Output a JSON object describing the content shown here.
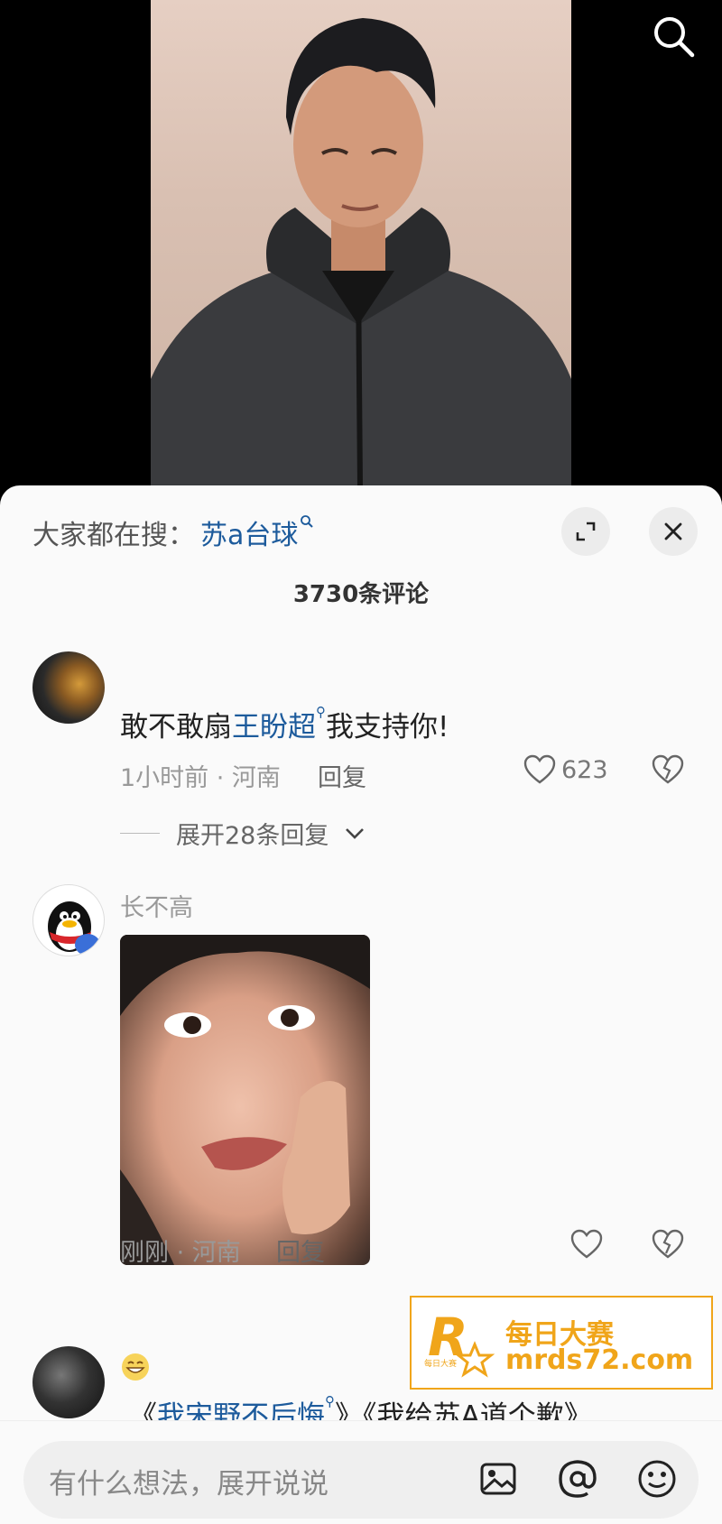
{
  "hot_search": {
    "prefix": "大家都在搜：",
    "term": "苏a台球"
  },
  "comment_count": "3730条评论",
  "comments": [
    {
      "text_before": "敢不敢扇",
      "link": "王盼超",
      "text_after": "我支持你!",
      "meta": "1小时前 · 河南",
      "reply_label": "回复",
      "likes": "623",
      "expand_label": "展开28条回复"
    },
    {
      "username": "长不高",
      "meta": "刚刚 · 河南",
      "reply_label": "回复"
    },
    {
      "text_prefix": "《",
      "link": "我宋野不后悔",
      "text_after": "》《我给苏A道个歉》"
    }
  ],
  "watermark": {
    "line1": "每日大赛",
    "line2": "mrds72.com",
    "badge": "R",
    "badge_small": "每日大赛"
  },
  "input": {
    "placeholder": "有什么想法，展开说说"
  },
  "icons": {
    "top_search": "search-icon",
    "expand": "expand-icon",
    "close": "close-icon",
    "like": "heart-icon",
    "dislike": "broken-heart-icon",
    "image": "image-icon",
    "mention": "at-icon",
    "emoji": "emoji-icon"
  }
}
